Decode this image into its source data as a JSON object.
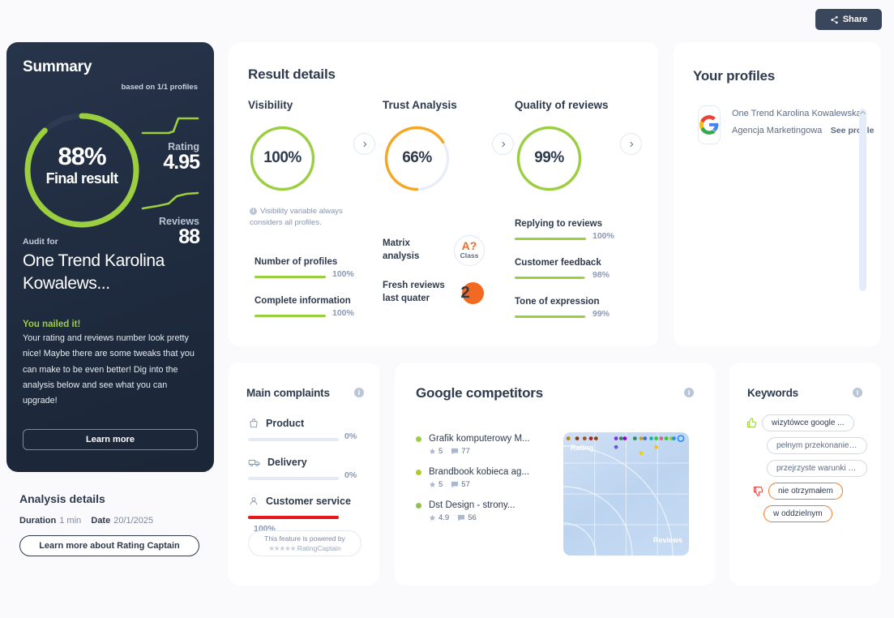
{
  "header": {
    "share_label": "Share",
    "share_icon": "share-icon"
  },
  "summary": {
    "title": "Summary",
    "based_on": "based on 1/1 profiles",
    "final_pct": "88%",
    "final_label": "Final result",
    "final_value": 88,
    "rating_label": "Rating",
    "rating_value": "4.95",
    "reviews_label": "Reviews",
    "reviews_value": "88",
    "audit_for_label": "Audit for",
    "audit_name": "One Trend Karolina Kowalews...",
    "nailed_title": "You nailed it!",
    "nailed_body": "Your rating and reviews number look pretty nice! Maybe there are some tweaks that you can make to be even better! Dig into the analysis below and see what you can upgrade!",
    "learn_more": "Learn more"
  },
  "analysis_details": {
    "title": "Analysis details",
    "duration_label": "Duration",
    "duration_value": "1 min",
    "date_label": "Date",
    "date_value": "20/1/2025",
    "button": "Learn more about Rating Captain"
  },
  "result_details": {
    "title": "Result details",
    "columns": [
      {
        "heading": "Visibility",
        "pct": "100%",
        "value": 100,
        "color": "#9ccf3f"
      },
      {
        "heading": "Trust Analysis",
        "pct": "66%",
        "value": 66,
        "color": "#f5a623"
      },
      {
        "heading": "Quality of reviews",
        "pct": "99%",
        "value": 99,
        "color": "#9ccf3f"
      }
    ],
    "visibility_note": "Visibility variable always considers all profiles.",
    "visibility_metrics": [
      {
        "label": "Number of profiles",
        "pct": "100%",
        "value": 100
      },
      {
        "label": "Complete information",
        "pct": "100%",
        "value": 100
      }
    ],
    "matrix_label": "Matrix analysis",
    "matrix_badge_value": "A?",
    "matrix_badge_caption": "Class",
    "fresh_label": "Fresh reviews last quater",
    "fresh_value": "2",
    "quality_metrics": [
      {
        "label": "Replying to reviews",
        "pct": "100%",
        "value": 100
      },
      {
        "label": "Customer feedback",
        "pct": "98%",
        "value": 98
      },
      {
        "label": "Tone of expression",
        "pct": "99%",
        "value": 99
      }
    ]
  },
  "your_profiles": {
    "title": "Your profiles",
    "logo_icon": "google-logo-icon",
    "profile_name": "One Trend Karolina Kowalewska - Agencja Marketingowa",
    "see_profile": "See profile"
  },
  "main_complaints": {
    "title": "Main complaints",
    "info_icon": "info-icon",
    "items": [
      {
        "label": "Product",
        "icon": "shopping-bag-icon",
        "pct": "0%",
        "value": 0,
        "color": "#e4eaf3"
      },
      {
        "label": "Delivery",
        "icon": "delivery-van-icon",
        "pct": "0%",
        "value": 0,
        "color": "#e4eaf3"
      },
      {
        "label": "Customer service",
        "icon": "person-icon",
        "pct": "100%",
        "value": 100,
        "color": "#e51b1b"
      }
    ],
    "powered_line1": "This feature is powered by",
    "powered_stars": "★★★★★",
    "powered_brand": "RatingCaptain"
  },
  "competitors": {
    "title": "Google competitors",
    "info_icon": "info-icon",
    "items": [
      {
        "name": "Grafik komputerowy M...",
        "rating": "5",
        "reviews": "77",
        "dot": "#9ccf3f"
      },
      {
        "name": "Brandbook kobieca ag...",
        "rating": "5",
        "reviews": "57",
        "dot": "#b3c72e"
      },
      {
        "name": "Dst Design - strony...",
        "rating": "4.9",
        "reviews": "56",
        "dot": "#8fc14a"
      }
    ],
    "chart_data": {
      "type": "scatter",
      "title": "",
      "xlabel": "Reviews",
      "ylabel": "Rating",
      "x": [
        4,
        11,
        17,
        22,
        26,
        42,
        46,
        42,
        49,
        57,
        62,
        65,
        62,
        70,
        74,
        78,
        74,
        82,
        86,
        88
      ],
      "y": [
        95,
        95,
        95,
        95,
        95,
        95,
        95,
        88,
        95,
        95,
        95,
        95,
        83,
        95,
        95,
        95,
        88,
        95,
        95,
        95
      ],
      "colors": [
        "#b8860b",
        "#8b3a1a",
        "#a0522d",
        "#b22222",
        "#8b4513",
        "#8a2be2",
        "#2e8b57",
        "#6a5acd",
        "#9400d3",
        "#2e8b57",
        "#c8a020",
        "#4169e1",
        "#f0d000",
        "#20b2aa",
        "#32cd32",
        "#e06090",
        "#f0c419",
        "#32cd32",
        "#9acd32",
        "#1e90ff"
      ],
      "xlim": [
        0,
        100
      ],
      "ylim": [
        0,
        100
      ],
      "grid": true
    }
  },
  "keywords": {
    "title": "Keywords",
    "info_icon": "info-icon",
    "items": [
      {
        "text": "wizytówce google ...",
        "sentiment": "positive",
        "icon": "thumbs-up-icon"
      },
      {
        "text": "pełnym przekonaniem...",
        "sentiment": "neutral",
        "icon": ""
      },
      {
        "text": "przejrzyste warunki w...",
        "sentiment": "neutral",
        "icon": ""
      },
      {
        "text": "nie otrzymałem",
        "sentiment": "negative",
        "icon": "thumbs-down-icon"
      },
      {
        "text": "w oddzielnym",
        "sentiment": "negative",
        "icon": ""
      }
    ]
  }
}
